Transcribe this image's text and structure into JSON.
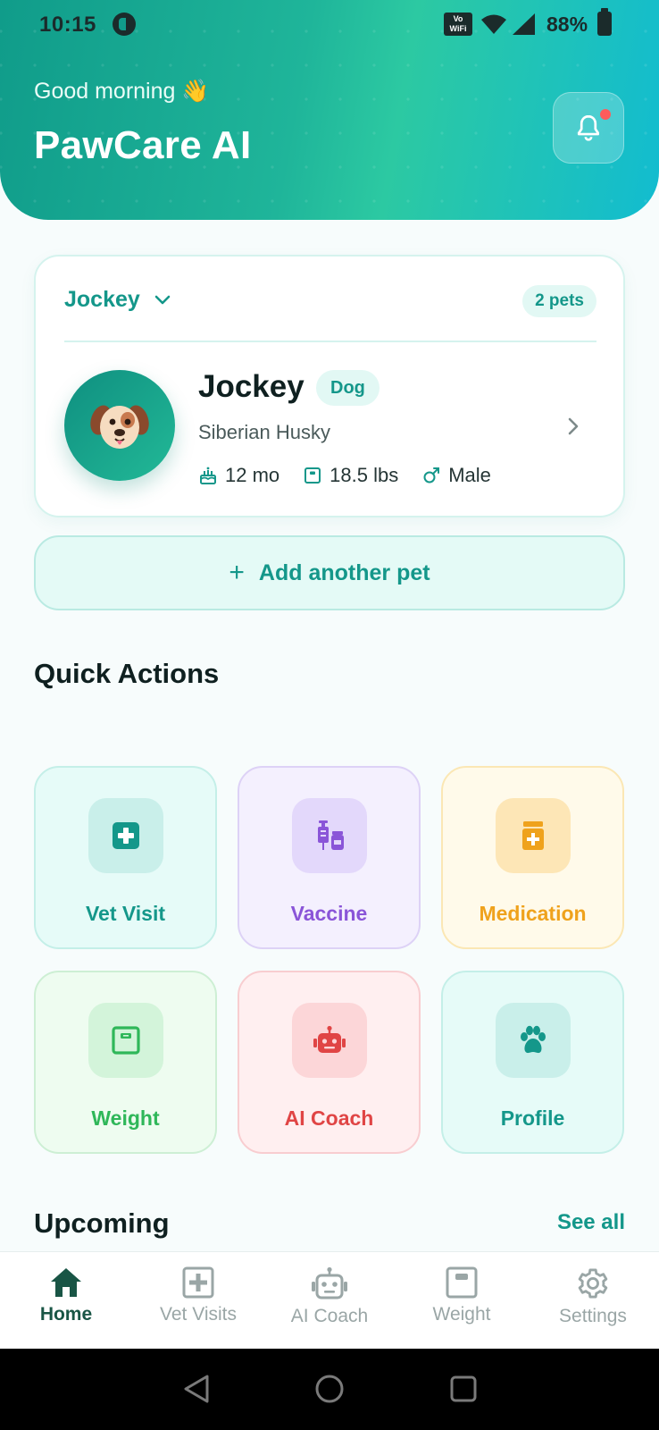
{
  "status_bar": {
    "time": "10:15",
    "vowifi_line1": "Vo",
    "vowifi_line2": "WiFi",
    "battery": "88%"
  },
  "header": {
    "greeting": "Good morning 👋",
    "title": "PawCare AI"
  },
  "pet_card": {
    "selected_pet": "Jockey",
    "pets_count": "2 pets",
    "name": "Jockey",
    "type": "Dog",
    "breed": "Siberian Husky",
    "age": "12 mo",
    "weight": "18.5 lbs",
    "sex": "Male"
  },
  "add_pet_label": "Add another pet",
  "quick_actions": {
    "title": "Quick Actions",
    "items": [
      {
        "label": "Vet Visit",
        "icon": "medical-plus-icon",
        "color": "#14978a"
      },
      {
        "label": "Vaccine",
        "icon": "syringe-icon",
        "color": "#8a55d8"
      },
      {
        "label": "Medication",
        "icon": "medicine-bottle-icon",
        "color": "#efa21c"
      },
      {
        "label": "Weight",
        "icon": "scale-icon",
        "color": "#2fb759"
      },
      {
        "label": "AI Coach",
        "icon": "robot-icon",
        "color": "#e04545"
      },
      {
        "label": "Profile",
        "icon": "paw-icon",
        "color": "#14978a"
      }
    ]
  },
  "upcoming": {
    "title": "Upcoming",
    "see_all": "See all"
  },
  "bottom_nav": {
    "active": "Home",
    "items": [
      {
        "label": "Home",
        "icon": "home-icon"
      },
      {
        "label": "Vet Visits",
        "icon": "medical-plus-icon"
      },
      {
        "label": "AI Coach",
        "icon": "robot-icon"
      },
      {
        "label": "Weight",
        "icon": "scale-icon"
      },
      {
        "label": "Settings",
        "icon": "gear-icon"
      }
    ]
  },
  "colors": {
    "accent": "#14978a",
    "header_gradient_start": "#109c8a",
    "header_gradient_end": "#12bcd0",
    "notification_dot": "#ff5b5b"
  }
}
